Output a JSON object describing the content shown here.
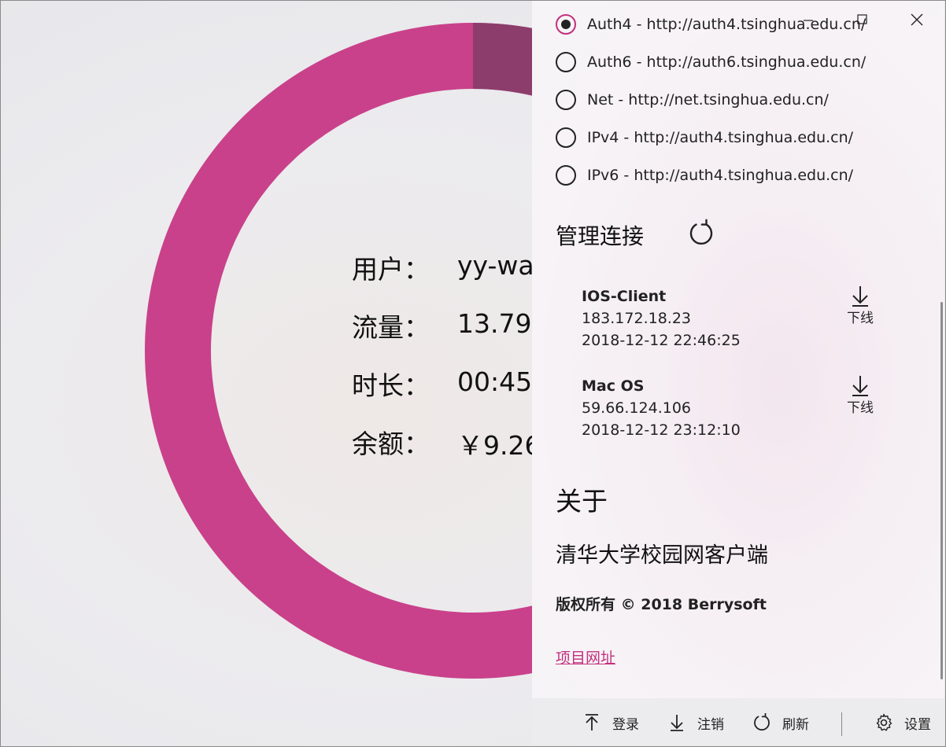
{
  "colors": {
    "accent": "#c2307e",
    "ring_main": "#c9418a",
    "ring_dark": "#a31c66",
    "ring_muted": "#8c3d6b"
  },
  "usage_ring": {
    "segments": [
      {
        "name": "main",
        "from_fraction": 0.46,
        "to_fraction": 1.21
      },
      {
        "name": "dark",
        "from_fraction": 0.21,
        "to_fraction": 0.46
      },
      {
        "name": "muted",
        "from_fraction": 0.0,
        "to_fraction": 0.21
      }
    ]
  },
  "info": {
    "user_label": "用户：",
    "user_value": "yy-wa",
    "traffic_label": "流量：",
    "traffic_value": "13.79",
    "duration_label": "时长：",
    "duration_value": "00:45:",
    "balance_label": "余额：",
    "balance_value": "￥9.26"
  },
  "servers": [
    {
      "label": "Auth4 - http://auth4.tsinghua.edu.cn/",
      "checked": true
    },
    {
      "label": "Auth6 - http://auth6.tsinghua.edu.cn/",
      "checked": false
    },
    {
      "label": "Net - http://net.tsinghua.edu.cn/",
      "checked": false
    },
    {
      "label": "IPv4 - http://auth4.tsinghua.edu.cn/",
      "checked": false
    },
    {
      "label": "IPv6 - http://auth4.tsinghua.edu.cn/",
      "checked": false
    }
  ],
  "manage": {
    "title": "管理连接",
    "refresh_icon": "refresh-icon"
  },
  "connections": [
    {
      "name": "IOS-Client",
      "ip": "183.172.18.23",
      "time": "2018-12-12 22:46:25",
      "action_label": "下线"
    },
    {
      "name": "Mac OS",
      "ip": "59.66.124.106",
      "time": "2018-12-12 23:12:10",
      "action_label": "下线"
    }
  ],
  "about": {
    "title": "关于",
    "app_name": "清华大学校园网客户端",
    "copyright": "版权所有 © 2018 Berrysoft",
    "link": "项目网址"
  },
  "commands": {
    "login": "登录",
    "logout": "注销",
    "refresh": "刷新",
    "settings": "设置"
  }
}
